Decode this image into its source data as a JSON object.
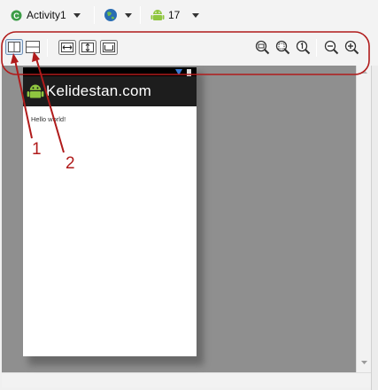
{
  "toolbar": {
    "activity_label": "Activity1",
    "api_label": "17"
  },
  "toolbar2": {
    "layout_buttons": [
      "layout-side-by-side-icon",
      "layout-stacked-icon"
    ],
    "fit_buttons": [
      "fit-width-icon",
      "fit-height-icon",
      "fit-screen-icon"
    ],
    "zoom_buttons": [
      "zoom-to-fit-icon",
      "zoom-real-size-icon",
      "zoom-actual-icon",
      "zoom-out-icon",
      "zoom-in-icon"
    ]
  },
  "phone": {
    "app_title": "Kelidestan.com",
    "content_text": "Hello world!"
  },
  "annotations": {
    "callout_1": "1",
    "callout_2": "2",
    "color": "#b01b1b"
  },
  "colors": {
    "canvas": "#8f8f8f",
    "action_bar": "#1d1d1d",
    "android_green": "#8fc63f",
    "accent_blue": "#2a6db3"
  }
}
